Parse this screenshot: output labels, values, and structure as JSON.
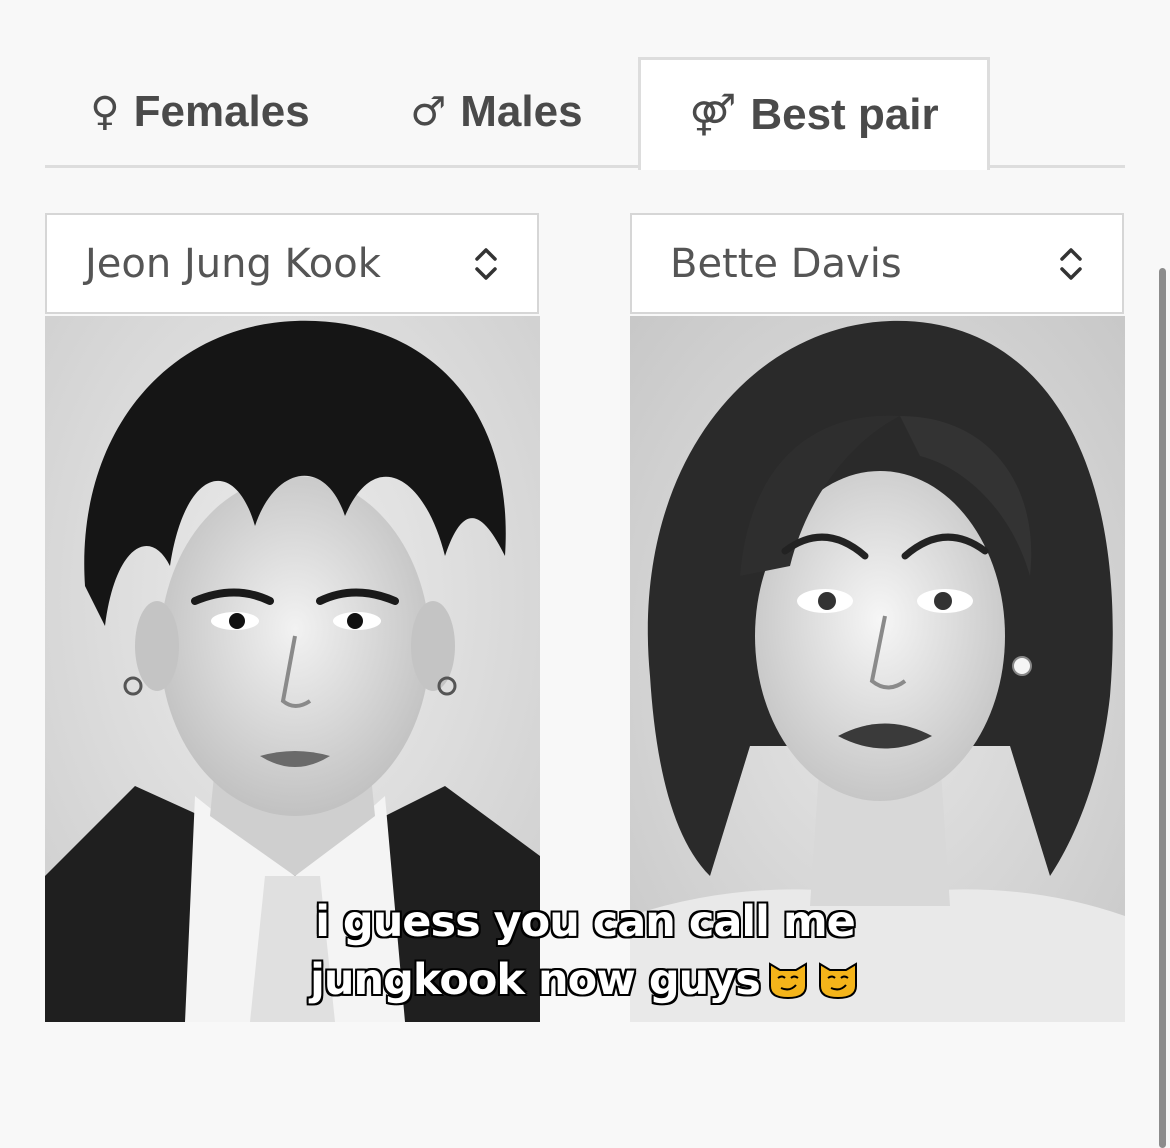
{
  "tabs": {
    "females": {
      "symbol": "♀",
      "label": "Females"
    },
    "males": {
      "symbol": "♂",
      "label": "Males"
    },
    "best_pair": {
      "symbol": "⚤",
      "label": "Best pair",
      "active": true
    }
  },
  "selects": {
    "left": {
      "value": "Jeon Jung Kook"
    },
    "right": {
      "value": "Bette Davis"
    }
  },
  "photos": {
    "left": {
      "subject": "Jeon Jung Kook"
    },
    "right": {
      "subject": "Bette Davis"
    }
  },
  "caption": {
    "line1": "i guess you can call me",
    "line2": "jungkook now guys",
    "emojis": [
      "smirking-cat-emoji",
      "smirking-cat-emoji"
    ]
  },
  "icons": {
    "select_chevron": "up-down-chevron-icon"
  },
  "colors": {
    "background": "#f8f8f8",
    "tab_text": "#4a4a4a",
    "border": "#dddddd",
    "select_text": "#555555"
  }
}
